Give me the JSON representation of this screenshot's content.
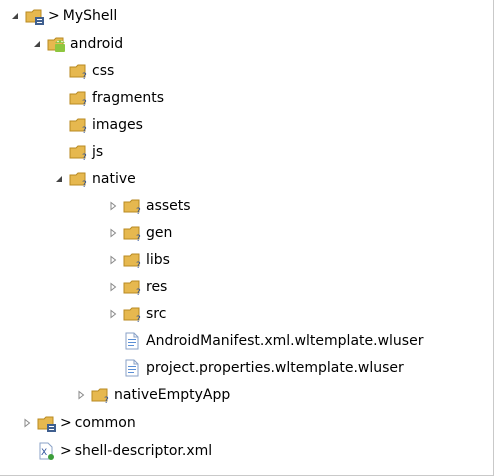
{
  "tree": {
    "decoration_prefix": ">",
    "rows": [
      {
        "label": "MyShell",
        "prefixed": true,
        "icon": "project-folder-icon",
        "expanded": true
      },
      {
        "label": "android",
        "prefixed": false,
        "icon": "android-folder-icon",
        "expanded": true
      },
      {
        "label": "css",
        "icon": "folder-icon"
      },
      {
        "label": "fragments",
        "icon": "folder-icon"
      },
      {
        "label": "images",
        "icon": "folder-icon"
      },
      {
        "label": "js",
        "icon": "folder-icon"
      },
      {
        "label": "native",
        "icon": "folder-icon",
        "expanded": true
      },
      {
        "label": "assets",
        "icon": "folder-icon",
        "expanded": false
      },
      {
        "label": "gen",
        "icon": "folder-icon",
        "expanded": false
      },
      {
        "label": "libs",
        "icon": "folder-icon",
        "expanded": false
      },
      {
        "label": "res",
        "icon": "folder-icon",
        "expanded": false
      },
      {
        "label": "src",
        "icon": "folder-icon",
        "expanded": false
      },
      {
        "label": "AndroidManifest.xml.wltemplate.wluser",
        "icon": "file-icon"
      },
      {
        "label": "project.properties.wltemplate.wluser",
        "icon": "file-icon"
      },
      {
        "label": "nativeEmptyApp",
        "icon": "folder-icon",
        "expanded": false
      },
      {
        "label": "common",
        "prefixed": true,
        "icon": "project-folder-icon",
        "expanded": false
      },
      {
        "label": "shell-descriptor.xml",
        "prefixed": true,
        "icon": "xml-file-icon"
      }
    ]
  },
  "colors": {
    "folder": "#e6b84f",
    "folder_dark": "#b88a22",
    "android_green": "#8ec63f",
    "twisty": "#8a8a8a",
    "file_blue": "#5b8fd6"
  }
}
